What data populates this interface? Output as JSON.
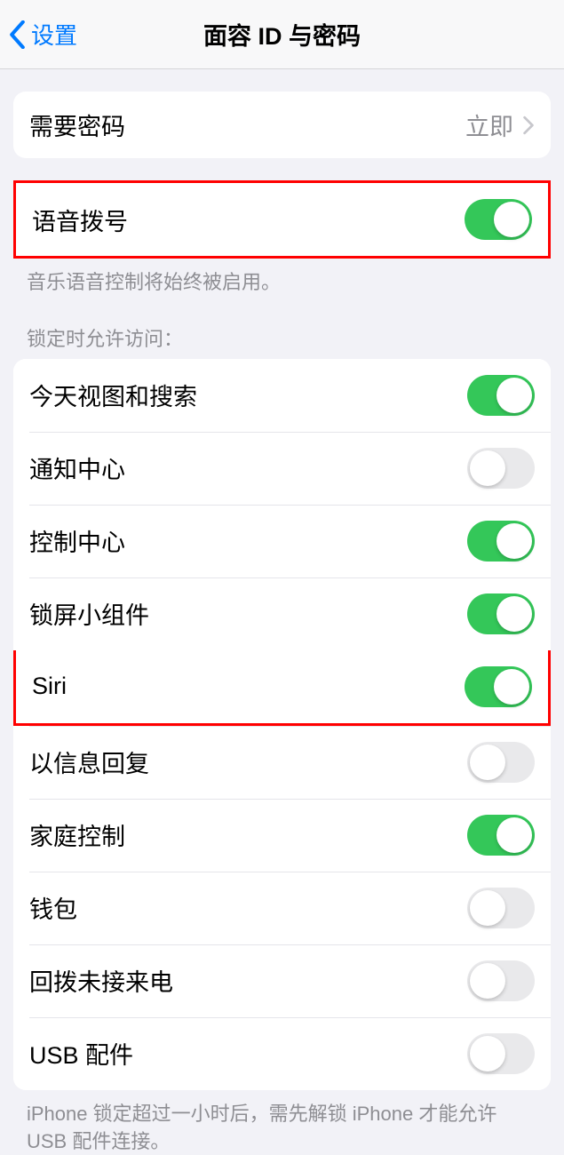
{
  "nav": {
    "back": "设置",
    "title": "面容 ID 与密码"
  },
  "passcode": {
    "label": "需要密码",
    "value": "立即"
  },
  "voice_dial": {
    "label": "语音拨号",
    "footer": "音乐语音控制将始终被启用。",
    "on": true
  },
  "lock_access": {
    "header": "锁定时允许访问：",
    "items": [
      {
        "label": "今天视图和搜索",
        "on": true,
        "highlighted": false
      },
      {
        "label": "通知中心",
        "on": false,
        "highlighted": false
      },
      {
        "label": "控制中心",
        "on": true,
        "highlighted": false
      },
      {
        "label": "锁屏小组件",
        "on": true,
        "highlighted": false
      },
      {
        "label": "Siri",
        "on": true,
        "highlighted": true
      },
      {
        "label": "以信息回复",
        "on": false,
        "highlighted": false
      },
      {
        "label": "家庭控制",
        "on": true,
        "highlighted": false
      },
      {
        "label": "钱包",
        "on": false,
        "highlighted": false
      },
      {
        "label": "回拨未接来电",
        "on": false,
        "highlighted": false
      },
      {
        "label": "USB 配件",
        "on": false,
        "highlighted": false
      }
    ],
    "footer": "iPhone 锁定超过一小时后，需先解锁 iPhone 才能允许 USB 配件连接。"
  }
}
